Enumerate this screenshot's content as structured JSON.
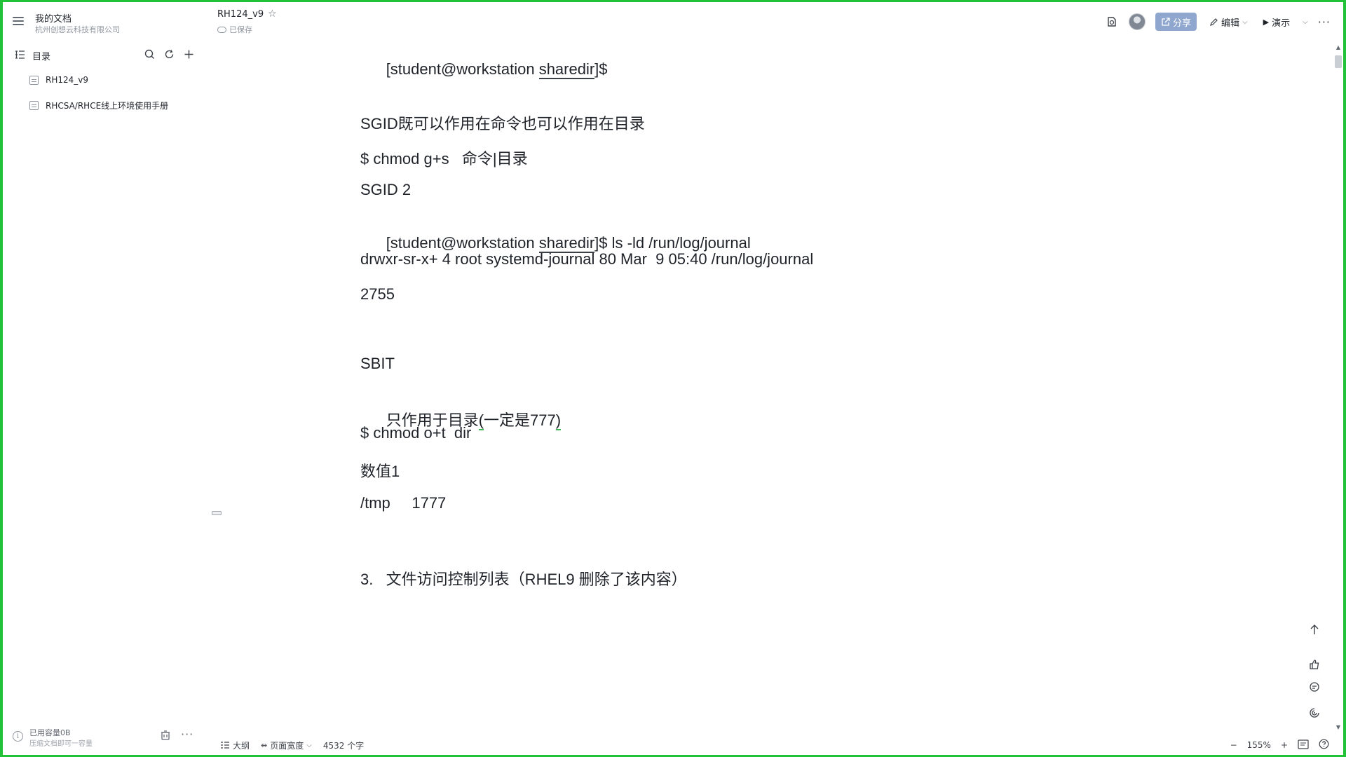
{
  "workspace": {
    "name": "我的文档",
    "org": "杭州创想云科技有限公司"
  },
  "toc": {
    "label": "目录"
  },
  "documents": [
    {
      "title": "RH124_v9"
    },
    {
      "title": "RHCSA/RHCE线上环境使用手册"
    }
  ],
  "header": {
    "doc_title": "RH124_v9",
    "save_status": "已保存"
  },
  "toolbar": {
    "share_label": "分享",
    "edit_label": "编辑",
    "present_label": "演示"
  },
  "content": {
    "lines": [
      {
        "prefix": "[student@workstation ",
        "link": "sharedir",
        "suffix": "]$"
      },
      {
        "text": "SGID既可以作用在命令也可以作用在目录"
      },
      {
        "text": "$ chmod g+s   命令|目录"
      },
      {
        "text": "SGID 2"
      },
      {
        "prefix": "[student@workstation ",
        "link": "sharedir",
        "suffix": "]$ ls -ld /run/log/journal"
      },
      {
        "text": "drwxr-sr-x+ 4 root systemd-journal 80 Mar  9 05:40 /run/log/journal"
      },
      {
        "text": "2755"
      },
      {
        "text": "SBIT"
      },
      {
        "pre": "只作用于目录",
        "mark": "(",
        "mid": "一定是777",
        "mark2": ")"
      },
      {
        "text": "$ chmod o+t  dir"
      },
      {
        "text": "数值1"
      },
      {
        "text": "/tmp     1777"
      },
      {
        "text": "3.   文件访问控制列表（RHEL9 删除了该内容）"
      }
    ]
  },
  "sidebar_footer": {
    "used": "已用容量0B",
    "hint": "压缩文档即可一容量"
  },
  "statusbar": {
    "outline_label": "大纲",
    "width_label": "页面宽度",
    "word_count": "4532 个字"
  },
  "zoom": {
    "level": "155%"
  }
}
